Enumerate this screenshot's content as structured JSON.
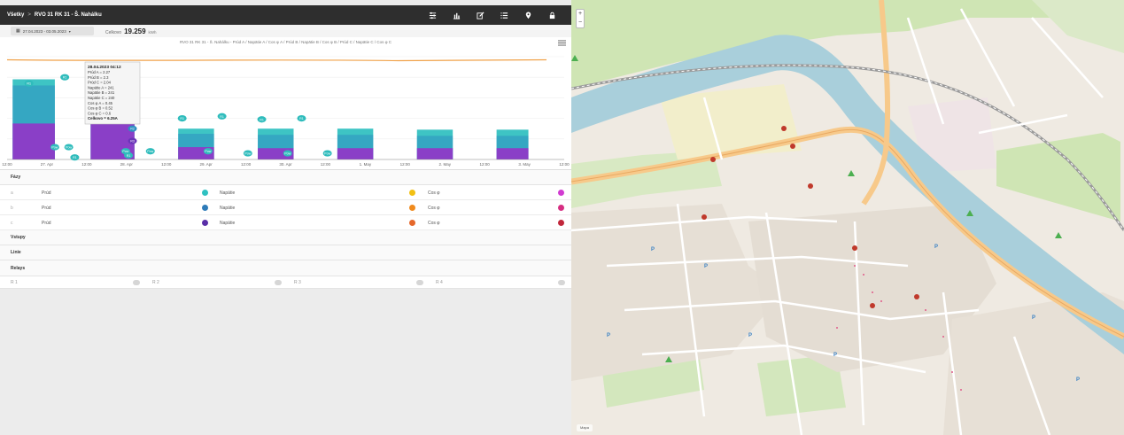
{
  "topbar": {
    "crumb_root": "Všetky",
    "crumb_sep": ">",
    "crumb_path": "RVO 31 RK 31 - Š. Nahálku",
    "tools": [
      {
        "name": "sliders-icon"
      },
      {
        "name": "bar-chart-icon"
      },
      {
        "name": "edit-icon"
      },
      {
        "name": "list-icon"
      },
      {
        "name": "map-pin-icon"
      },
      {
        "name": "lock-icon"
      }
    ]
  },
  "datebar": {
    "range": "27.04.2023 - 03.05.2023",
    "total_label": "Celkovo",
    "total_value": "19.259",
    "total_unit": "kWh"
  },
  "chart_data": {
    "type": "area",
    "title": "RVO 31 RK 31 - Š. Nahálku - Prúd A / Napätie A / Cos φ A / Prúd B / Napätie B / Cos φ B / Prúd C / Napätie C / Cos φ C",
    "x_tick_labels": [
      "12:00",
      "27. Apr",
      "12:00",
      "28. Apr",
      "12:00",
      "29. Apr",
      "12:00",
      "30. Apr",
      "12:00",
      "1. May",
      "12:00",
      "2. May",
      "12:00",
      "3. May",
      "12:00"
    ],
    "day_blocks": [
      {
        "day": "27. Apr",
        "start": 0.52,
        "end": 1.05,
        "a": 0.78,
        "b": 0.72,
        "c": 0.35
      },
      {
        "day": "28. Apr",
        "start": 1.5,
        "end": 2.05,
        "a": 0.82,
        "b": 0.74,
        "c": 0.38
      },
      {
        "day": "29. Apr",
        "start": 2.6,
        "end": 3.05,
        "a": 0.3,
        "b": 0.25,
        "c": 0.12
      },
      {
        "day": "30. Apr",
        "start": 3.6,
        "end": 4.05,
        "a": 0.3,
        "b": 0.24,
        "c": 0.11
      },
      {
        "day": "1. May",
        "start": 4.6,
        "end": 5.05,
        "a": 0.3,
        "b": 0.24,
        "c": 0.11
      },
      {
        "day": "2. May",
        "start": 5.6,
        "end": 6.05,
        "a": 0.29,
        "b": 0.23,
        "c": 0.11
      },
      {
        "day": "3. May",
        "start": 6.6,
        "end": 7.0,
        "a": 0.29,
        "b": 0.23,
        "c": 0.11
      }
    ],
    "voltage_level": 0.97,
    "markers": [
      {
        "x": 0.55,
        "level": 0.74,
        "label": "R1"
      },
      {
        "x": 1.2,
        "level": 0.12,
        "label": "Pow"
      },
      {
        "x": 1.7,
        "level": 0.02,
        "label": "R1"
      },
      {
        "x": 1.45,
        "level": 0.8,
        "label": "R1"
      },
      {
        "x": 1.55,
        "level": 0.12,
        "label": "Pow"
      },
      {
        "x": 3.0,
        "level": 0.45,
        "label": "R1"
      },
      {
        "x": 3.15,
        "level": 0.3,
        "label": "R2"
      },
      {
        "x": 3.15,
        "level": 0.18,
        "label": "R3"
      },
      {
        "x": 2.98,
        "level": 0.08,
        "label": "Pow"
      },
      {
        "x": 3.05,
        "level": 0.04,
        "label": "R1"
      },
      {
        "x": 3.6,
        "level": 0.08,
        "label": "Pow"
      },
      {
        "x": 4.4,
        "level": 0.4,
        "label": "R1"
      },
      {
        "x": 5.05,
        "level": 0.08,
        "label": "Pow"
      },
      {
        "x": 5.4,
        "level": 0.42,
        "label": "R1"
      },
      {
        "x": 6.05,
        "level": 0.06,
        "label": "Pow"
      },
      {
        "x": 6.4,
        "level": 0.39,
        "label": "R1"
      },
      {
        "x": 7.05,
        "level": 0.06,
        "label": "Pow"
      },
      {
        "x": 7.4,
        "level": 0.4,
        "label": "R1"
      },
      {
        "x": 8.05,
        "level": 0.06,
        "label": "Pow"
      }
    ],
    "tooltip": {
      "heading": "28.04.2023 04:12",
      "lines": [
        "Prúd A = 2.27",
        "Prúd B = 2.3",
        "Prúd C = 2.04",
        "Napätie A = 241",
        "Napätie B = 241",
        "Napätie C = 240",
        "Cos φ A = 0.45",
        "Cos φ B = 0.52",
        "Cos φ C = 0.6"
      ],
      "total": "Celkovo = 6.25A"
    },
    "colors": {
      "a": "#3ec4c4",
      "b": "#2e8fc1",
      "c": "#8a3fc7",
      "voltage": "#f0a24a"
    }
  },
  "sections": {
    "phases": "Fázy",
    "inputs": "Vstupy",
    "lines": "Linie",
    "relays": "Relays"
  },
  "phase_rows": [
    {
      "phase": "a",
      "current": "Prúd",
      "voltage": "Napätie",
      "cos": "Cos φ",
      "c1": "#2fc1c1",
      "c2": "#f2c013",
      "c3": "#d13bd1"
    },
    {
      "phase": "b",
      "current": "Prúd",
      "voltage": "Napätie",
      "cos": "Cos φ",
      "c1": "#2e7bb8",
      "c2": "#f08a1c",
      "c3": "#d62e82"
    },
    {
      "phase": "c",
      "current": "Prúd",
      "voltage": "Napätie",
      "cos": "Cos φ",
      "c1": "#5a2fa8",
      "c2": "#e5682b",
      "c3": "#c1273b"
    }
  ],
  "relays": [
    "R 1",
    "R 2",
    "R 3",
    "R 4"
  ],
  "map": {
    "zoom_in": "+",
    "zoom_out": "−",
    "attribution": "Mapa"
  }
}
